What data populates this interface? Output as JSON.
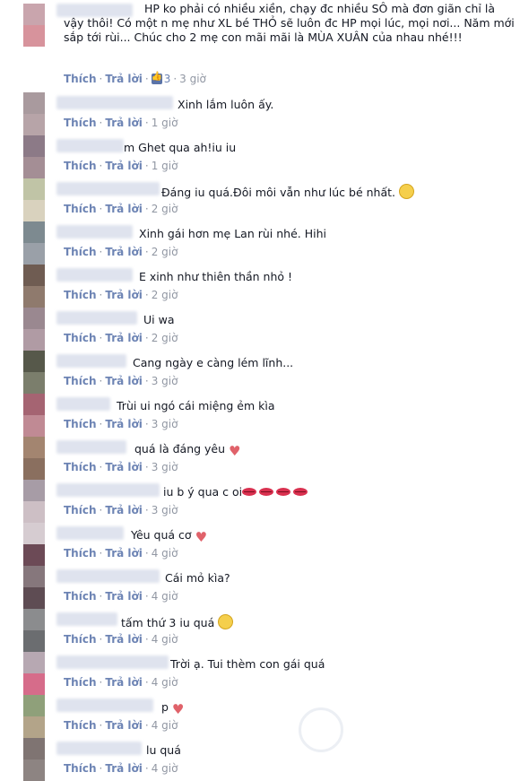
{
  "actions": {
    "like": "Thích",
    "reply": "Trả lời",
    "separator": "·"
  },
  "comments": [
    {
      "text": "HP ko phải có nhiều xiền, chạy đc nhiều SÔ mà đơn giãn chỉ là vậy thôi! Có một n mẹ như XL bé THỎ sẽ luôn đc HP mọi lúc, mọi nơi... Năm mới sắp tới rùi... Chúc cho 2 mẹ con mãi mãi là MÙA XUÂN của nhau nhé!!!",
      "likes": "3",
      "time": "3 giờ"
    },
    {
      "text": "Xinh lắm luôn ấy.",
      "time": "1 giờ"
    },
    {
      "text": "m Ghet qua ah!iu iu",
      "time": "1 giờ"
    },
    {
      "text": "Đáng iu quá.Đôi môi vẫn như lúc bé nhất.",
      "emoji": "kiss-emoji",
      "time": "2 giờ"
    },
    {
      "text": "Xinh gái hơn mẹ Lan rùi nhé. Hihi",
      "time": "2 giờ"
    },
    {
      "text": "E xinh như thiên thần nhỏ !",
      "time": "2 giờ"
    },
    {
      "text": "Ui wa",
      "time": "2 giờ"
    },
    {
      "text": "Cang ngày e càng lém lĩnh...",
      "time": "3 giờ"
    },
    {
      "text": "Trùi ui ngó cái miệng ẻm kìa",
      "time": "3 giờ"
    },
    {
      "text": "quá là đáng yêu",
      "emoji": "heart-emoji",
      "time": "3 giờ"
    },
    {
      "text": "iu b ý qua c oi",
      "emoji": "lips-emoji",
      "time": "3 giờ"
    },
    {
      "text": "Yêu quá cơ",
      "emoji": "heart-emoji",
      "time": "4 giờ"
    },
    {
      "text": "Cái mỏ kìa?",
      "time": "4 giờ"
    },
    {
      "text": "tấm thứ 3 iu quá",
      "emoji": "smiley-emoji",
      "time": "4 giờ"
    },
    {
      "text": "Trời ạ. Tui thèm con gái quá",
      "time": "4 giờ"
    },
    {
      "text": "p",
      "emoji": "heart-emoji",
      "time": "4 giờ"
    },
    {
      "text": "lu quá",
      "time": "4 giờ"
    }
  ],
  "colors": {
    "link": "#6d84b4",
    "time": "#9197a3",
    "text": "#141823"
  }
}
